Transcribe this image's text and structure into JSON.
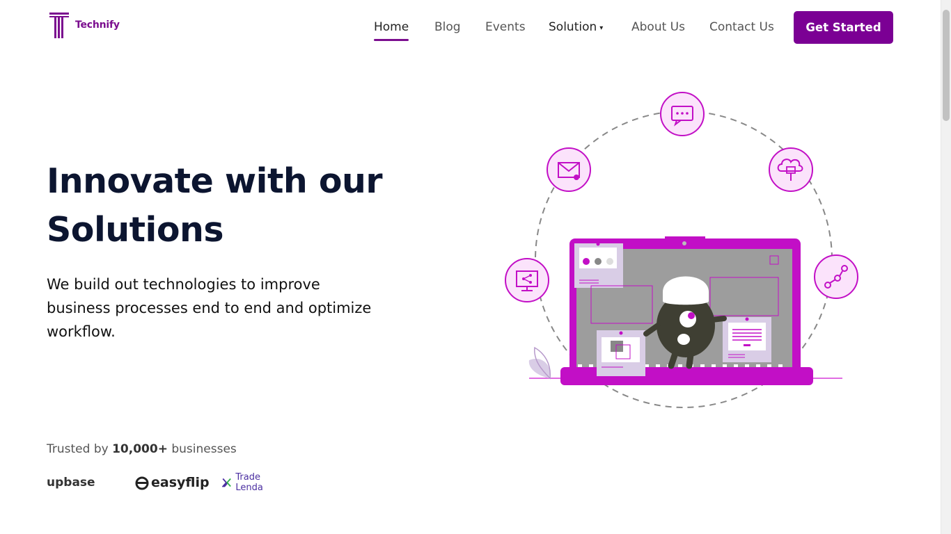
{
  "brand": {
    "name": "Technify",
    "accent": "#7b0094",
    "logo_icon": "technify-t-logo"
  },
  "nav": {
    "items": [
      {
        "label": "Home",
        "active": true
      },
      {
        "label": "Blog",
        "active": false
      },
      {
        "label": "Events",
        "active": false
      },
      {
        "label": "Solution",
        "active": false,
        "dropdown": true
      },
      {
        "label": "About Us",
        "active": false
      },
      {
        "label": "Contact Us",
        "active": false
      }
    ],
    "dropdown_caret": "▾",
    "cta_label": "Get Started"
  },
  "hero": {
    "title_line1": "Innovate with our",
    "title_line2": "Solutions",
    "subtitle": "We build out technologies to improve business processes end to end and optimize workflow.",
    "illustration_icons": [
      "chat-icon",
      "mail-icon",
      "cloud-network-icon",
      "screen-share-icon",
      "workflow-icon"
    ]
  },
  "trusted": {
    "prefix": "Trusted by",
    "count": "10,000+",
    "suffix": "businesses",
    "brands": [
      "upbase",
      "easyflip",
      "Trade Lenda"
    ]
  },
  "colors": {
    "heading": "#0c1530",
    "magenta": "#c20fc6",
    "circle_fill": "#fbe3fb"
  }
}
